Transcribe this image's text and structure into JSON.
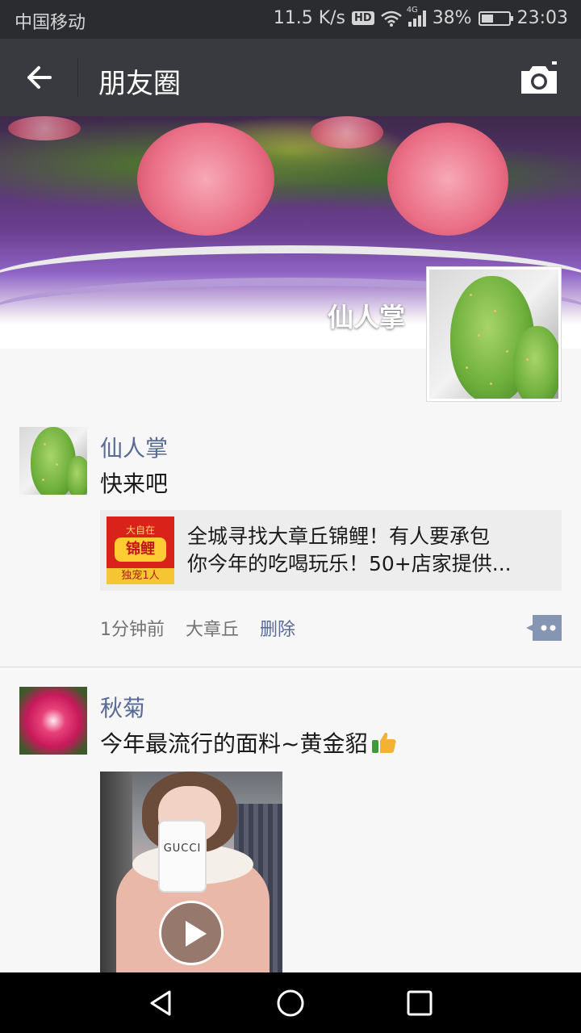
{
  "status_bar": {
    "carrier": "中国移动",
    "speed": "11.5 K/s",
    "hd": "HD",
    "network": "4G",
    "battery": "38%",
    "time": "23:03"
  },
  "title_bar": {
    "title": "朋友圈",
    "back_icon": "back-arrow-icon",
    "camera_icon": "camera-icon"
  },
  "cover": {
    "name": "仙人掌"
  },
  "posts": [
    {
      "name": "仙人掌",
      "text": "快来吧",
      "link": {
        "thumb_top": "大自在",
        "thumb_main": "锦鲤",
        "thumb_bottom": "独宠1人",
        "title_line1": "全城寻找大章丘锦鲤！有人要承包",
        "title_line2": "你今年的吃喝玩乐！50+店家提供..."
      },
      "time": "1分钟前",
      "location": "大章丘",
      "delete": "删除"
    },
    {
      "name": "秋菊",
      "text": "今年最流行的面料~黄金貂",
      "emoji": "thumbs-up",
      "video_phone_text": "GUCCI"
    }
  ],
  "colors": {
    "link_name": "#576b95",
    "titlebar": "#393a3f",
    "statusbar": "#2b2c2f"
  }
}
